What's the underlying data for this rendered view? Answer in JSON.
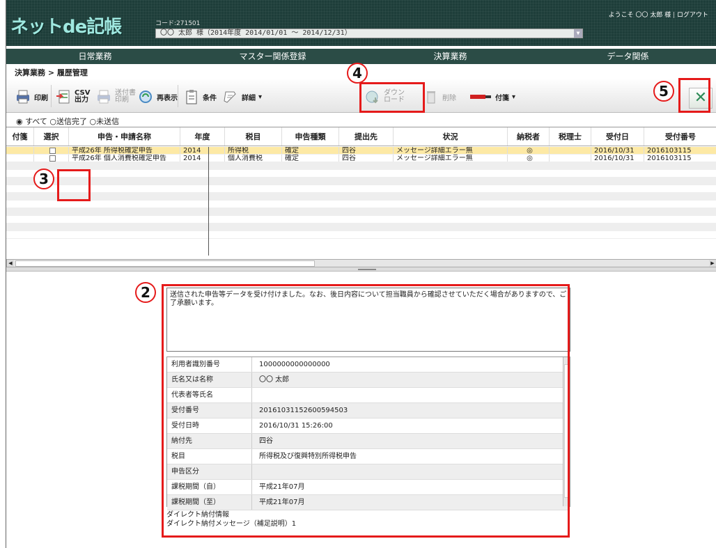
{
  "app": {
    "logo": "ネットde記帳",
    "code_label": "コード:271501",
    "user_selector": "〇〇 太郎 様（2014年度 2014/01/01 ～ 2014/12/31）",
    "welcome": "ようこそ 〇〇 太郎 様",
    "logout": "ログアウト"
  },
  "menu": [
    "日常業務",
    "マスター関係登録",
    "決算業務",
    "データ関係"
  ],
  "breadcrumb": "決算業務 > 履歴管理",
  "toolbar": {
    "print": "印刷",
    "csv": "CSV\n出力",
    "send_print": "送付書\n印刷",
    "refresh": "再表示",
    "condition": "条件",
    "detail": "詳細",
    "download": "ダウン\nロード",
    "delete": "削除",
    "tag": "付箋"
  },
  "filters": {
    "all": "すべて",
    "sent": "送信完了",
    "unsent": "未送信"
  },
  "grid": {
    "headers": [
      "付箋",
      "選択",
      "申告・申請名称",
      "年度",
      "税目",
      "申告種類",
      "提出先",
      "状況",
      "納税者",
      "税理士",
      "受付日",
      "受付番号"
    ],
    "rows": [
      [
        "",
        "",
        "平成26年 所得税確定申告",
        "2014",
        "所得税",
        "確定",
        "四谷",
        "メッセージ詳細エラー無",
        "◎",
        "",
        "2016/10/31",
        "2016103115"
      ],
      [
        "",
        "",
        "平成26年 個人消費税確定申告",
        "2014",
        "個人消費税",
        "確定",
        "四谷",
        "メッセージ詳細エラー無",
        "◎",
        "",
        "2016/10/31",
        "2016103115"
      ]
    ]
  },
  "message": "送信された申告等データを受け付けました。なお、後日内容について担当職員から確認させていただく場合がありますので、ご了承願います。",
  "detail": [
    {
      "k": "利用者識別番号",
      "v": "1000000000000000"
    },
    {
      "k": "氏名又は名称",
      "v": "〇〇 太郎"
    },
    {
      "k": "代表者等氏名",
      "v": ""
    },
    {
      "k": "受付番号",
      "v": "20161031152600594503"
    },
    {
      "k": "受付日時",
      "v": "2016/10/31 15:26:00"
    },
    {
      "k": "納付先",
      "v": "四谷"
    },
    {
      "k": "税目",
      "v": "所得税及び復興特別所得税申告"
    },
    {
      "k": "申告区分",
      "v": ""
    },
    {
      "k": "課税期間（自）",
      "v": "平成21年07月"
    },
    {
      "k": "課税期間（至）",
      "v": "平成21年07月"
    }
  ],
  "extra": [
    "ダイレクト納付情報",
    "ダイレクト納付メッセージ（補足説明）1"
  ],
  "callouts": [
    "2",
    "3",
    "4",
    "5"
  ],
  "icons": {
    "close": "close-icon"
  }
}
